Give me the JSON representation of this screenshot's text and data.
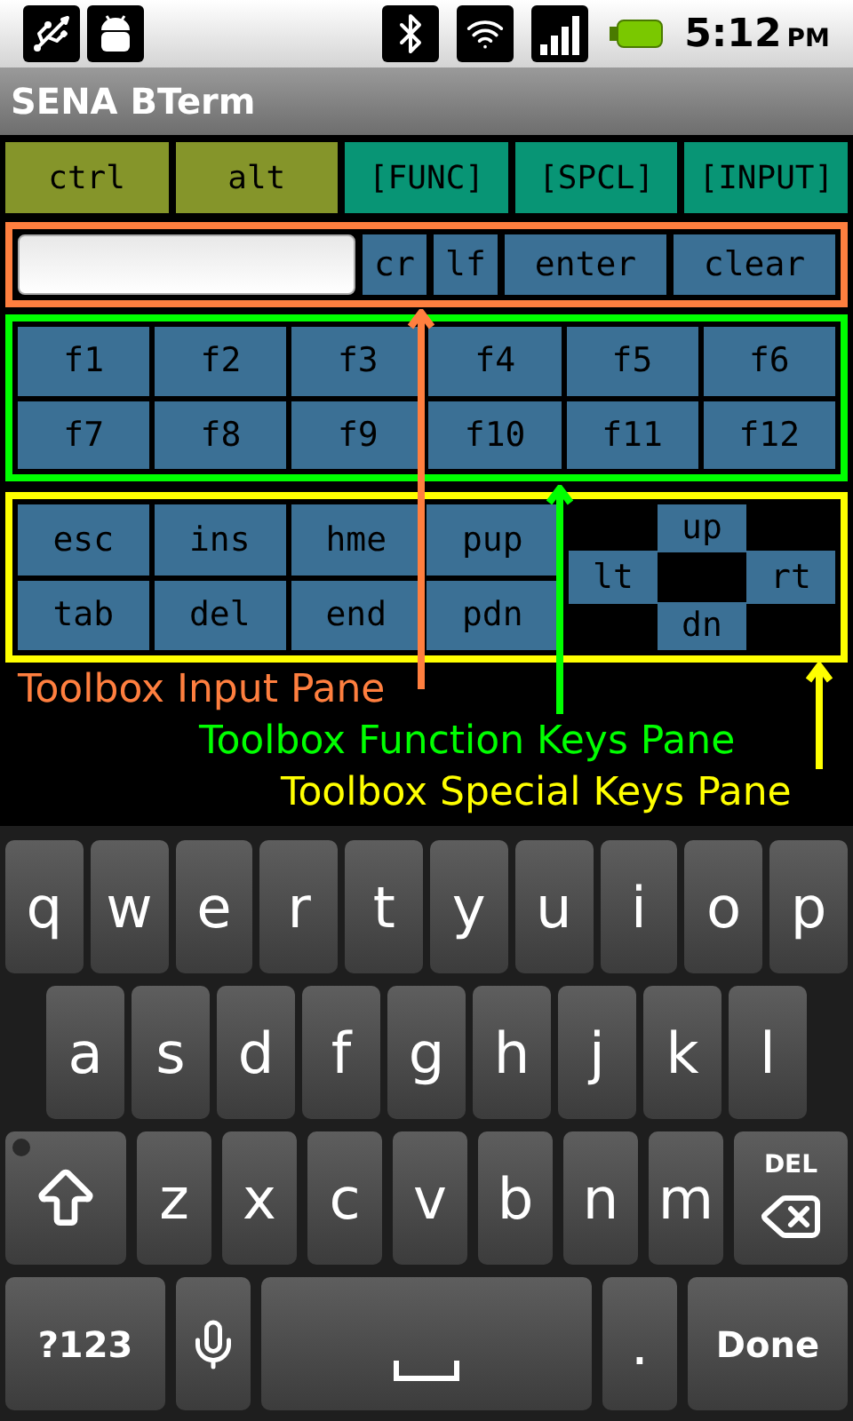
{
  "status_bar": {
    "time": "5:12",
    "period": "PM"
  },
  "window": {
    "title": "SENA BTerm"
  },
  "mode_buttons": [
    {
      "label": "ctrl",
      "kind": "modifier"
    },
    {
      "label": "alt",
      "kind": "modifier"
    },
    {
      "label": "[FUNC]",
      "kind": "pane"
    },
    {
      "label": "[SPCL]",
      "kind": "pane"
    },
    {
      "label": "[INPUT]",
      "kind": "pane"
    }
  ],
  "input_pane": {
    "keys": [
      "cr",
      "lf",
      "enter",
      "clear"
    ]
  },
  "function_pane": {
    "keys": [
      "f1",
      "f2",
      "f3",
      "f4",
      "f5",
      "f6",
      "f7",
      "f8",
      "f9",
      "f10",
      "f11",
      "f12"
    ]
  },
  "special_pane": {
    "keys": [
      "esc",
      "ins",
      "hme",
      "pup",
      "tab",
      "del",
      "end",
      "pdn"
    ],
    "arrows": {
      "up": "up",
      "left": "lt",
      "right": "rt",
      "down": "dn"
    }
  },
  "annotations": [
    {
      "text": "Toolbox Input Pane",
      "color": "#ff7f3f"
    },
    {
      "text": "Toolbox Function Keys Pane",
      "color": "#00ff00"
    },
    {
      "text": "Toolbox Special Keys Pane",
      "color": "#ffff00"
    }
  ],
  "keyboard": {
    "rows": [
      {
        "keys": [
          {
            "kind": "char",
            "label": "q"
          },
          {
            "kind": "char",
            "label": "w"
          },
          {
            "kind": "char",
            "label": "e"
          },
          {
            "kind": "char",
            "label": "r"
          },
          {
            "kind": "char",
            "label": "t"
          },
          {
            "kind": "char",
            "label": "y"
          },
          {
            "kind": "char",
            "label": "u"
          },
          {
            "kind": "char",
            "label": "i"
          },
          {
            "kind": "char",
            "label": "o"
          },
          {
            "kind": "char",
            "label": "p"
          }
        ]
      },
      {
        "keys": [
          {
            "kind": "char",
            "label": "a"
          },
          {
            "kind": "char",
            "label": "s"
          },
          {
            "kind": "char",
            "label": "d"
          },
          {
            "kind": "char",
            "label": "f"
          },
          {
            "kind": "char",
            "label": "g"
          },
          {
            "kind": "char",
            "label": "h"
          },
          {
            "kind": "char",
            "label": "j"
          },
          {
            "kind": "char",
            "label": "k"
          },
          {
            "kind": "char",
            "label": "l"
          }
        ]
      },
      {
        "keys": [
          {
            "kind": "shift"
          },
          {
            "kind": "char",
            "label": "z"
          },
          {
            "kind": "char",
            "label": "x"
          },
          {
            "kind": "char",
            "label": "c"
          },
          {
            "kind": "char",
            "label": "v"
          },
          {
            "kind": "char",
            "label": "b"
          },
          {
            "kind": "char",
            "label": "n"
          },
          {
            "kind": "char",
            "label": "m"
          },
          {
            "kind": "delete",
            "label": "DEL"
          }
        ]
      },
      {
        "keys": [
          {
            "kind": "symbols",
            "label": "?123"
          },
          {
            "kind": "mic"
          },
          {
            "kind": "space"
          },
          {
            "kind": "char",
            "label": "."
          },
          {
            "kind": "done",
            "label": "Done"
          }
        ]
      }
    ]
  }
}
